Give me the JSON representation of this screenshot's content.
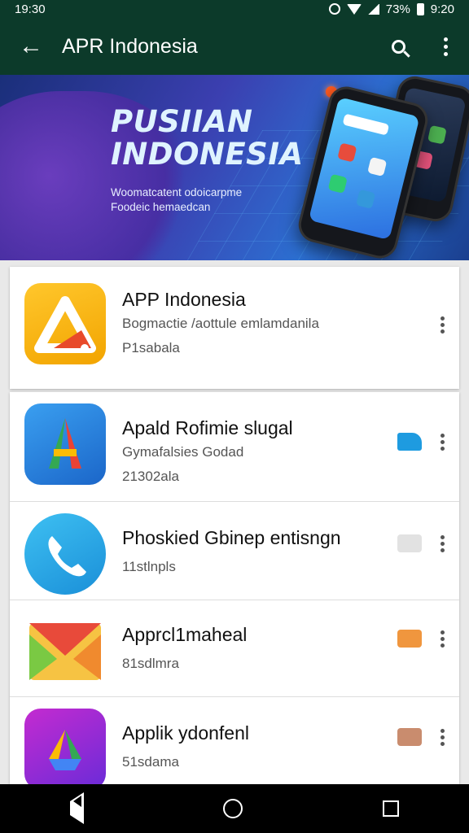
{
  "status_bar": {
    "time_left": "19:30",
    "battery": "73%",
    "time_right": "9:20"
  },
  "app_bar": {
    "title": "APR Indonesia",
    "back_icon": "arrow-left-icon",
    "search_icon": "search-icon",
    "menu_icon": "more-vert-icon"
  },
  "banner": {
    "title_line1": "PUSIIAN",
    "title_line2": "INDONESIA",
    "subtitle_line1": "Woomatcatent odoicarpme",
    "subtitle_line2": "Foodeic hemaedcan"
  },
  "featured": {
    "name": "APP Indonesia",
    "meta1": "Bogmactie /aottule emlamdanila",
    "meta2": "P1sabala"
  },
  "apps": [
    {
      "name": "Apald Rofimie slugal",
      "meta1": "Gymafalsies Godad",
      "meta2": "21302ala",
      "badge_color": "#1e9be0"
    },
    {
      "name": "Phoskied Gbinep entisngn",
      "meta1": "11stlnpls",
      "meta2": "",
      "badge_color": "#e2e2e2"
    },
    {
      "name": "Apprcl1maheal",
      "meta1": "81sdlmra",
      "meta2": "",
      "badge_color": "#f0963e"
    },
    {
      "name": "Applik ydonfenl",
      "meta1": "51sdama",
      "meta2": "",
      "badge_color": "#c98c6e"
    }
  ],
  "colors": {
    "app_bar": "#0c3a2a",
    "nav_bar": "#000000"
  },
  "nav": {
    "back_icon": "nav-back-icon",
    "home_icon": "nav-home-icon",
    "recents_icon": "nav-recents-icon"
  }
}
